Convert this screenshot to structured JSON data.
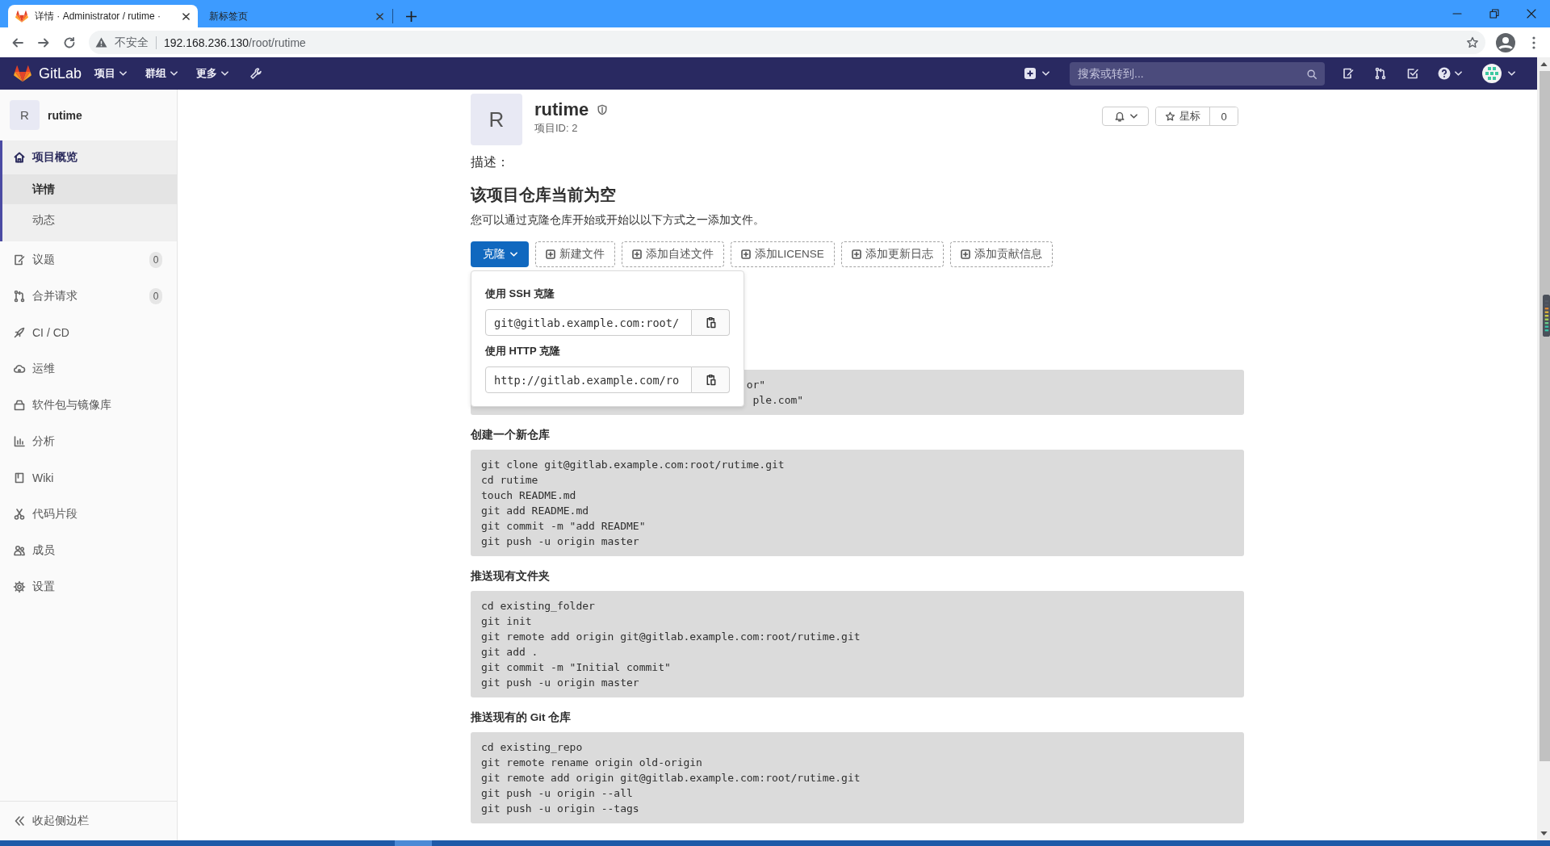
{
  "browser": {
    "tabs": [
      {
        "kind": "page",
        "title": "详情 · Administrator / rutime ·",
        "selected": true
      },
      {
        "kind": "blank",
        "title": "新标签页",
        "selected": false
      }
    ],
    "security_label": "不安全",
    "url": {
      "host": "192.168.236.130",
      "path": "/root/rutime"
    }
  },
  "header": {
    "brand": "GitLab",
    "menus": [
      "项目",
      "群组",
      "更多"
    ],
    "search": {
      "placeholder": "搜索或转到..."
    }
  },
  "sidebar": {
    "project": {
      "avatar": "R",
      "name": "rutime"
    },
    "items": [
      {
        "label": "项目概览",
        "selected": true,
        "children": [
          {
            "label": "详情",
            "selected": true
          },
          {
            "label": "动态",
            "selected": false
          }
        ]
      },
      {
        "label": "议题",
        "count": "0",
        "selected": false
      },
      {
        "label": "合并请求",
        "count": "0",
        "selected": false
      },
      {
        "label": "CI / CD",
        "selected": false
      },
      {
        "label": "运维",
        "selected": false
      },
      {
        "label": "软件包与镜像库",
        "selected": false
      },
      {
        "label": "分析",
        "selected": false
      },
      {
        "label": "Wiki",
        "selected": false
      },
      {
        "label": "代码片段",
        "selected": false
      },
      {
        "label": "成员",
        "selected": false
      },
      {
        "label": "设置",
        "selected": false
      }
    ],
    "collapse_label": "收起侧边栏"
  },
  "project": {
    "avatar": "R",
    "name": "rutime",
    "id_label": "项目ID: 2",
    "star_label": "星标",
    "star_count": "0",
    "description_label": "描述："
  },
  "empty_repo": {
    "title": "该项目仓库当前为空",
    "hint": "您可以通过克隆仓库开始或开始以以下方式之一添加文件。",
    "clone_button": "克隆",
    "actions": [
      "新建文件",
      "添加自述文件",
      "添加LICENSE",
      "添加更新日志",
      "添加贡献信息"
    ]
  },
  "clone_dropdown": {
    "open": true,
    "options": [
      {
        "label": "使用 SSH 克隆",
        "value": "git@gitlab.example.com:root/"
      },
      {
        "label": "使用 HTTP 克隆",
        "value": "http://gitlab.example.com/ro"
      }
    ]
  },
  "instructions": [
    {
      "kind": "covered",
      "lines": [
        "or\"",
        "ple.com\""
      ]
    },
    {
      "kind": "section",
      "title": "创建一个新仓库",
      "lines": [
        "git clone git@gitlab.example.com:root/rutime.git",
        "cd rutime",
        "touch README.md",
        "git add README.md",
        "git commit -m \"add README\"",
        "git push -u origin master"
      ]
    },
    {
      "kind": "section",
      "title": "推送现有文件夹",
      "lines": [
        "cd existing_folder",
        "git init",
        "git remote add origin git@gitlab.example.com:root/rutime.git",
        "git add .",
        "git commit -m \"Initial commit\"",
        "git push -u origin master"
      ]
    },
    {
      "kind": "section",
      "title": "推送现有的 Git 仓库",
      "lines": [
        "cd existing_repo",
        "git remote rename origin old-origin",
        "git remote add origin git@gitlab.example.com:root/rutime.git",
        "git push -u origin --all",
        "git push -u origin --tags"
      ]
    }
  ]
}
